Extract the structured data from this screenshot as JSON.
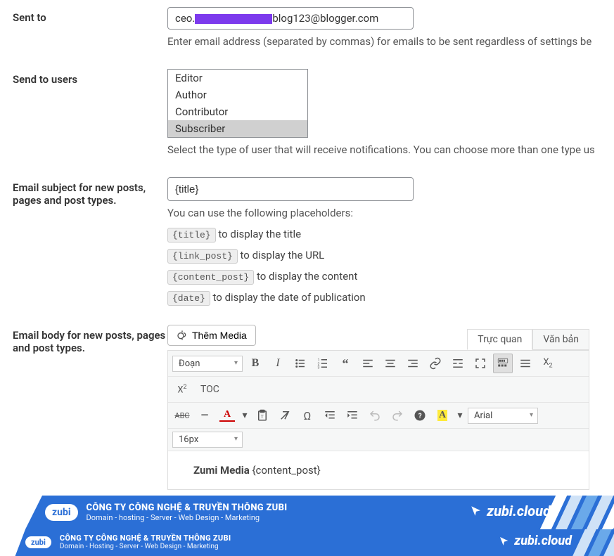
{
  "fields": {
    "sent_to": {
      "label": "Sent to",
      "value_prefix": "ceo.",
      "value_suffix": "blog123@blogger.com",
      "help": "Enter email address (separated by commas) for emails to be sent regardless of settings be"
    },
    "send_to_users": {
      "label": "Send to users",
      "options": [
        "Editor",
        "Author",
        "Contributor",
        "Subscriber"
      ],
      "selected": "Subscriber",
      "help": "Select the type of user that will receive notifications. You can choose more than one type us"
    },
    "email_subject": {
      "label": "Email subject for new posts, pages and post types.",
      "value": "{title}",
      "help_intro": "You can use the following placeholders:",
      "placeholders": [
        {
          "code": "{title}",
          "desc": " to display the title"
        },
        {
          "code": "{link_post}",
          "desc": " to display the URL"
        },
        {
          "code": "{content_post}",
          "desc": " to display the content"
        },
        {
          "code": "{date}",
          "desc": " to display the date of publication"
        }
      ]
    },
    "email_body": {
      "label": "Email body for new posts, pages and post types.",
      "add_media": "Thêm Media",
      "tabs": {
        "visual": "Trực quan",
        "text": "Văn bản"
      },
      "format_select": "Đoạn",
      "toc": "TOC",
      "font_family": "Arial",
      "font_size": "16px",
      "content_bold": "Zumi Media",
      "content_rest": " {content_post}"
    }
  },
  "banner": {
    "company_upper": "CÔNG TY CÔNG NGHỆ & TRUYỀN THÔNG ZUBI",
    "services": "Domain - hosting - Server - Web Design - Marketing",
    "services2": "Domain - Hosting - Server - Web Design - Marketing",
    "logo_text": "zubi",
    "site": "zubi.cloud"
  }
}
